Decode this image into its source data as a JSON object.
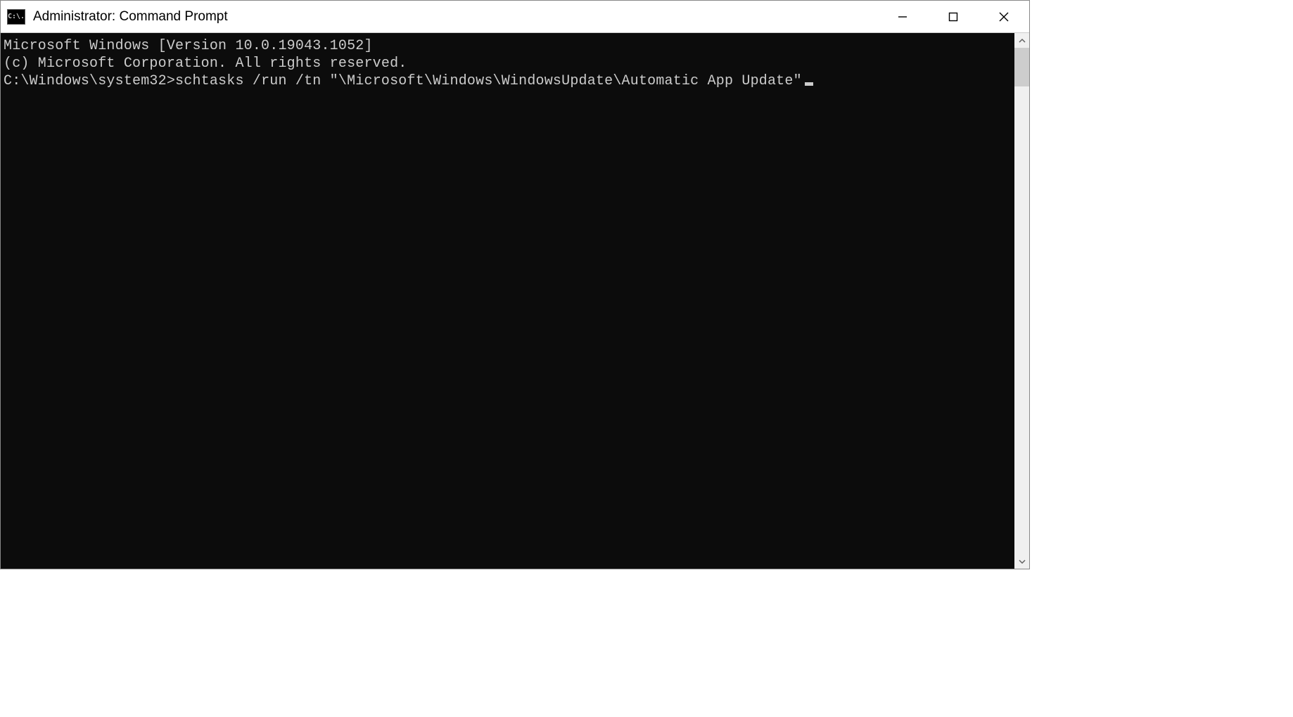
{
  "titlebar": {
    "icon_label": "C:\\.",
    "title": "Administrator: Command Prompt"
  },
  "terminal": {
    "line1": "Microsoft Windows [Version 10.0.19043.1052]",
    "line2": "(c) Microsoft Corporation. All rights reserved.",
    "blank": "",
    "prompt": "C:\\Windows\\system32>",
    "command": "schtasks /run /tn \"\\Microsoft\\Windows\\WindowsUpdate\\Automatic App Update\""
  }
}
